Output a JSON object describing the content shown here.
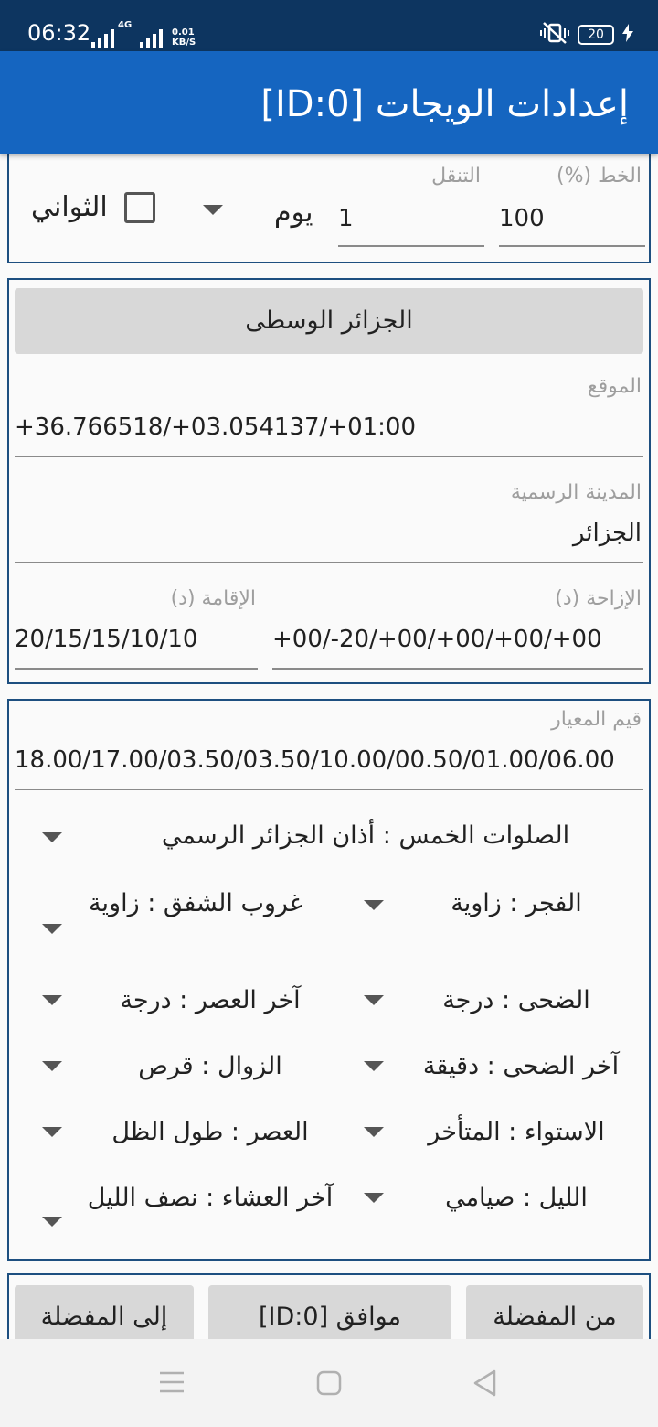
{
  "status_bar": {
    "time": "06:32",
    "network_type": "4G",
    "speed_value": "0.01",
    "speed_unit": "KB/S",
    "battery": "20",
    "icons": [
      "signal-icon",
      "signal-4g-icon",
      "mute-vibrate-icon",
      "battery-icon",
      "charging-icon"
    ]
  },
  "app_bar": {
    "title": "إعدادات الويجات [ID:0]"
  },
  "top_panel": {
    "font_label": "الخط (%)",
    "font_value": "100",
    "shift_label": "التنقل",
    "shift_value": "1",
    "unit_value": "يوم",
    "seconds_label": "الثواني",
    "seconds_checked": false
  },
  "location_panel": {
    "city_button": "الجزائر الوسطى",
    "location_label": "الموقع",
    "location_value": "+36.766518/+03.054137/+01:00",
    "official_city_label": "المدينة الرسمية",
    "official_city_value": "الجزائر",
    "offset_label": "الإزاحة (د)",
    "offset_value": "+00/-20/+00/+00/+00/+00",
    "iqama_label": "الإقامة (د)",
    "iqama_value": "20/15/15/10/10"
  },
  "criteria_panel": {
    "criteria_label": "قيم المعيار",
    "criteria_value": "18.00/17.00/03.50/03.50/10.00/00.50/01.00/06.00",
    "five_prayers": "الصلوات الخمس : أذان الجزائر الرسمي",
    "rows": [
      {
        "right": "الفجر : زاوية",
        "left": "غروب الشفق : زاوية"
      },
      {
        "right": "الضحى : درجة",
        "left": "آخر العصر : درجة"
      },
      {
        "right": "آخر الضحى : دقيقة",
        "left": "الزوال : قرص"
      },
      {
        "right": "الاستواء : المتأخر",
        "left": "العصر : طول الظل"
      },
      {
        "right": "الليل : صيامي",
        "left": "آخر العشاء : نصف الليل"
      }
    ]
  },
  "bottom_buttons": {
    "from_favorites": "من المفضلة",
    "ok": "موافق [ID:0]",
    "to_favorites": "إلى المفضلة"
  },
  "nav_bar": {
    "icons": [
      "menu-icon",
      "home-icon",
      "back-icon"
    ]
  },
  "colors": {
    "status_bar": "#0d3560",
    "app_bar": "#1565c0",
    "panel_border": "#1d4f80",
    "button": "#d8d8d8"
  }
}
